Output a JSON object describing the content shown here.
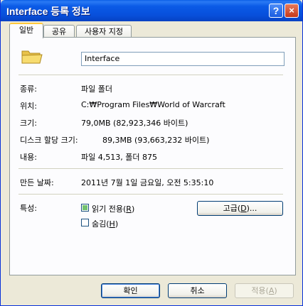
{
  "window": {
    "title": "Interface 등록 정보",
    "help_glyph": "?",
    "close_glyph": "×"
  },
  "tabs": [
    {
      "label": "일반"
    },
    {
      "label": "공유"
    },
    {
      "label": "사용자 지정"
    }
  ],
  "general": {
    "icon": "folder-icon",
    "name": "Interface",
    "type_label": "종류:",
    "type_value": "파일 폴더",
    "location_label": "위치:",
    "location_value": "C:₩Program Files₩World of Warcraft",
    "size_label": "크기:",
    "size_value": "79,0MB (82,923,346 바이트)",
    "disk_label": "디스크 할당 크기:",
    "disk_value": "89,3MB (93,663,232 바이트)",
    "contents_label": "내용:",
    "contents_value": "파일 4,513, 폴더 875",
    "created_label": "만든 날짜:",
    "created_value": "2011년 7월 1일 금요일, 오전 5:35:10",
    "attributes_label": "특성:",
    "readonly": {
      "text": "읽기 전용(",
      "key": "R",
      "end": ")",
      "state": "indeterminate"
    },
    "hidden": {
      "text": "숨김(",
      "key": "H",
      "end": ")",
      "state": "unchecked"
    },
    "advanced": {
      "text": "고급(",
      "key": "D",
      "end": ")..."
    }
  },
  "buttons": {
    "ok": "확인",
    "cancel": "취소",
    "apply_text": "적용(",
    "apply_key": "A",
    "apply_end": ")"
  },
  "colors": {
    "title_bar": "#0a5ae6",
    "dialog_bg": "#ece9d8",
    "active_tab_accent": "#ffc83c"
  }
}
